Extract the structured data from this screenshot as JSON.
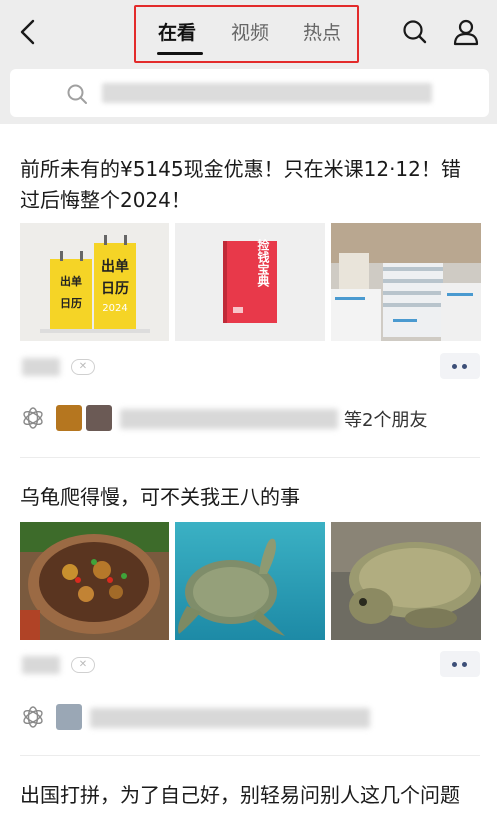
{
  "header": {
    "tabs": [
      {
        "label": "在看",
        "active": true
      },
      {
        "label": "视频",
        "active": false
      },
      {
        "label": "热点",
        "active": false
      }
    ]
  },
  "search": {
    "placeholder": ""
  },
  "articles": [
    {
      "title": "前所未有的¥5145现金优惠！只在米课12·12！错过后悔整个2024！",
      "images": [
        "calendar-books",
        "red-book",
        "stacked-books"
      ],
      "book_labels": {
        "yellow_text": "出单",
        "yellow_text2": "日历",
        "year": "2024",
        "red_text": "捡钱宝典"
      },
      "friends_suffix": "等2个朋友"
    },
    {
      "title": "乌龟爬得慢，可不关我王八的事",
      "images": [
        "turtle-dish",
        "sea-turtle",
        "softshell-turtle"
      ],
      "friends_suffix": ""
    },
    {
      "title": "出国打拼，为了自己好，别轻易问别人这几个问题"
    }
  ],
  "colors": {
    "header_bg": "#ededed",
    "highlight_box": "#e32b2b",
    "more_dots": "#3d4f78"
  }
}
